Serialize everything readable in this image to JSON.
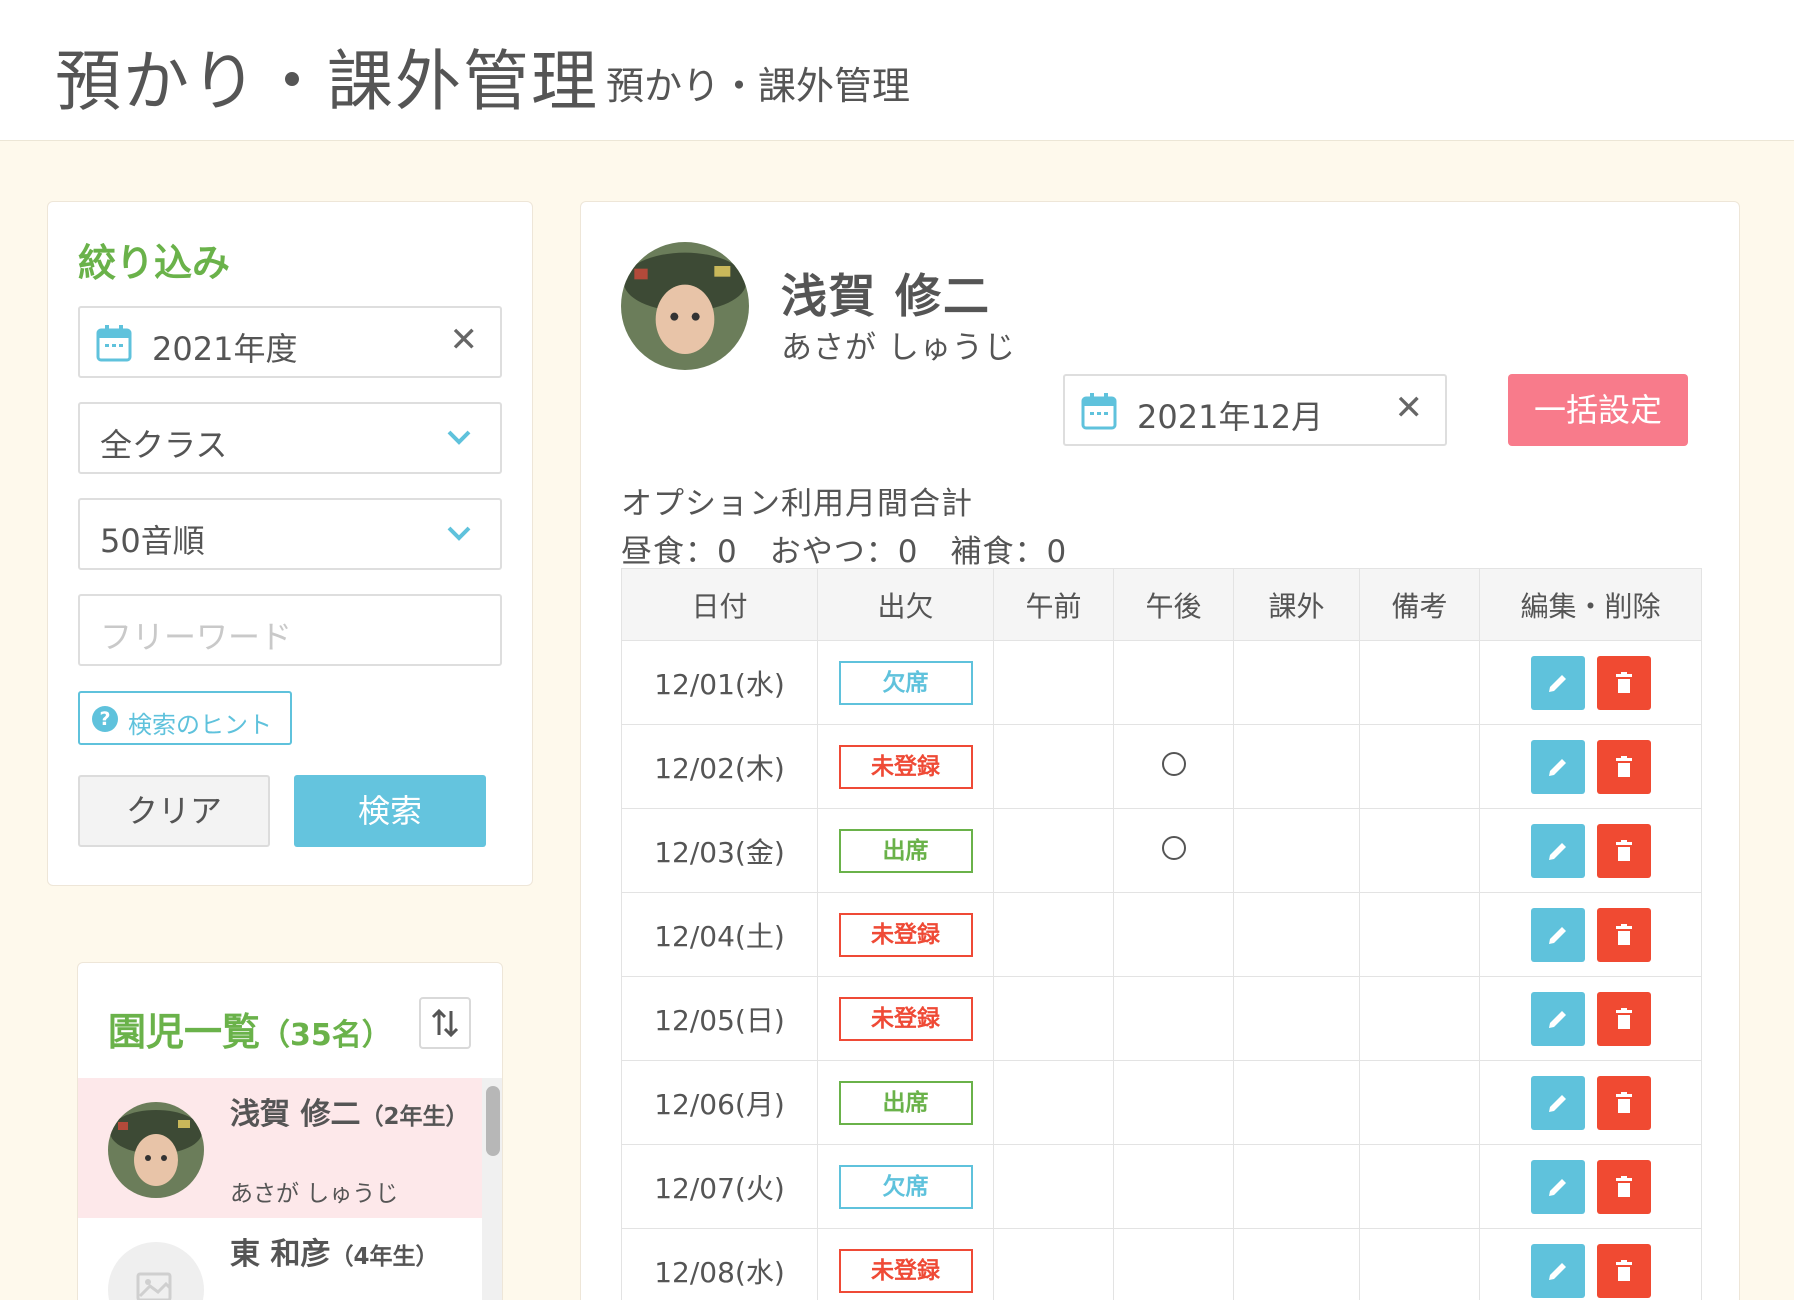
{
  "header": {
    "title": "預かり・課外管理",
    "subtitle": "預かり・課外管理"
  },
  "filter": {
    "heading": "絞り込み",
    "year_value": "2021年度",
    "class_value": "全クラス",
    "sort_value": "50音順",
    "freeword_placeholder": "フリーワード",
    "hint_label": "検索のヒント",
    "clear_label": "クリア",
    "search_label": "検索"
  },
  "child_list": {
    "heading": "園児一覧",
    "count": "（35名）",
    "items": [
      {
        "name": "浅賀 修二",
        "grade": "（2年生）",
        "kana": "あさが しゅうじ",
        "selected": true
      },
      {
        "name": "東 和彦",
        "grade": "（4年生）",
        "kana": "",
        "selected": false
      }
    ]
  },
  "detail": {
    "name": "浅賀 修二",
    "kana": "あさが しゅうじ",
    "month_value": "2021年12月",
    "bulk_label": "一括設定",
    "summary_title": "オプション利用月間合計",
    "summary_values": "昼食：0　おやつ：0　補食：0"
  },
  "table": {
    "headers": [
      "日付",
      "出欠",
      "午前",
      "午後",
      "課外",
      "備考",
      "編集・削除"
    ],
    "rows": [
      {
        "date": "12/01(水)",
        "status": "欠席",
        "status_type": "absent",
        "am": "",
        "pm": "",
        "extra": "",
        "note": ""
      },
      {
        "date": "12/02(木)",
        "status": "未登録",
        "status_type": "unreg",
        "am": "",
        "pm": "○",
        "extra": "",
        "note": ""
      },
      {
        "date": "12/03(金)",
        "status": "出席",
        "status_type": "present",
        "am": "",
        "pm": "○",
        "extra": "",
        "note": ""
      },
      {
        "date": "12/04(土)",
        "status": "未登録",
        "status_type": "unreg",
        "am": "",
        "pm": "",
        "extra": "",
        "note": ""
      },
      {
        "date": "12/05(日)",
        "status": "未登録",
        "status_type": "unreg",
        "am": "",
        "pm": "",
        "extra": "",
        "note": ""
      },
      {
        "date": "12/06(月)",
        "status": "出席",
        "status_type": "present",
        "am": "",
        "pm": "",
        "extra": "",
        "note": ""
      },
      {
        "date": "12/07(火)",
        "status": "欠席",
        "status_type": "absent",
        "am": "",
        "pm": "",
        "extra": "",
        "note": ""
      },
      {
        "date": "12/08(水)",
        "status": "未登録",
        "status_type": "unreg",
        "am": "",
        "pm": "",
        "extra": "",
        "note": ""
      }
    ]
  },
  "icons": {
    "calendar": "calendar-icon",
    "clear": "close-icon",
    "chevron": "chevron-down-icon",
    "help": "help-icon",
    "sort": "sort-icon",
    "edit": "pencil-icon",
    "delete": "trash-icon"
  },
  "colors": {
    "accent_green": "#6ab24a",
    "accent_blue": "#5fc2dc",
    "accent_pink": "#f87b8b",
    "danger_red": "#f04a32",
    "background": "#fef9ec"
  }
}
